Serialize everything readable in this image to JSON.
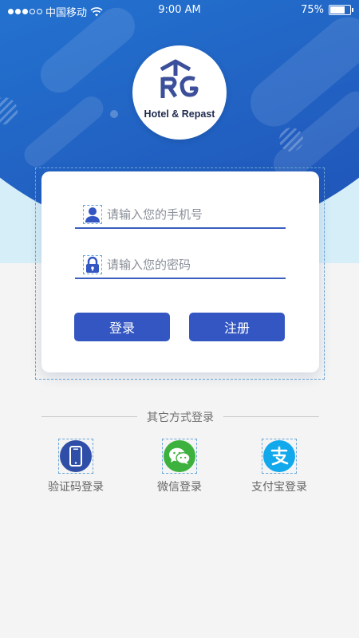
{
  "status_bar": {
    "carrier": "中国移动",
    "time": "9:00 AM",
    "battery": "75%",
    "battery_level": 0.75
  },
  "brand": {
    "logo_text": "Hotel & Repast"
  },
  "login": {
    "phone_placeholder": "请输入您的手机号",
    "password_placeholder": "请输入您的密码",
    "login_label": "登录",
    "register_label": "注册"
  },
  "alt_login": {
    "title": "其它方式登录",
    "methods": [
      {
        "label": "验证码登录",
        "icon": "phone-icon",
        "color": "#2f4ea8"
      },
      {
        "label": "微信登录",
        "icon": "wechat-icon",
        "color": "#3db13d"
      },
      {
        "label": "支付宝登录",
        "icon": "alipay-icon",
        "color": "#11a8ec"
      }
    ]
  },
  "colors": {
    "primary": "#3356c2",
    "hero_light": "#2ea2e6",
    "hero_dark": "#1f4fb4",
    "background": "#f4f4f4"
  }
}
